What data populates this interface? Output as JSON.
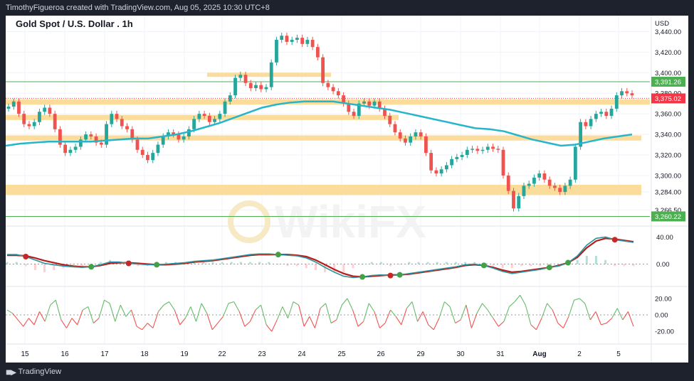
{
  "header": {
    "credit": "TimothyFigueroa created with TradingView.com, Aug 05, 2025 10:30 UTC+8"
  },
  "footer": {
    "brand": "TradingView"
  },
  "watermark": "WikiFX",
  "chart_data": {
    "type": "line",
    "title": "Gold Spot / U.S. Dollar . 1h",
    "currency": "USD",
    "price_ticks": [
      "3,440.00",
      "3,420.00",
      "3,400.00",
      "3,380.00",
      "3,360.00",
      "3,340.00",
      "3,320.00",
      "3,300.00",
      "3,284.00",
      "3,266.50"
    ],
    "current_price": "3,375.02",
    "line_labels": [
      "3,391.26",
      "3,260.22"
    ],
    "x_ticks": [
      "15",
      "16",
      "17",
      "18",
      "19",
      "22",
      "23",
      "24",
      "25",
      "26",
      "29",
      "30",
      "31",
      "Aug",
      "2",
      "5"
    ],
    "support_resistance_zones": [
      {
        "low": 3396,
        "high": 3400
      },
      {
        "low": 3369,
        "high": 3374
      },
      {
        "low": 3354,
        "high": 3359
      },
      {
        "low": 3334,
        "high": 3339
      },
      {
        "low": 3281,
        "high": 3291
      }
    ],
    "horizontal_lines": [
      3391.26,
      3260.22
    ],
    "price_series": {
      "name": "XAUUSD 1h close",
      "values": [
        3367,
        3372,
        3360,
        3350,
        3348,
        3352,
        3362,
        3366,
        3360,
        3345,
        3330,
        3322,
        3325,
        3328,
        3335,
        3340,
        3338,
        3332,
        3330,
        3350,
        3360,
        3355,
        3348,
        3345,
        3335,
        3325,
        3320,
        3315,
        3322,
        3330,
        3338,
        3342,
        3340,
        3335,
        3338,
        3345,
        3355,
        3360,
        3358,
        3352,
        3355,
        3360,
        3372,
        3378,
        3395,
        3398,
        3390,
        3385,
        3388,
        3384,
        3386,
        3410,
        3432,
        3436,
        3430,
        3432,
        3434,
        3428,
        3432,
        3425,
        3415,
        3390,
        3386,
        3382,
        3378,
        3370,
        3362,
        3358,
        3370,
        3372,
        3368,
        3372,
        3365,
        3358,
        3350,
        3342,
        3336,
        3332,
        3338,
        3342,
        3338,
        3322,
        3305,
        3302,
        3306,
        3310,
        3316,
        3318,
        3320,
        3325,
        3326,
        3324,
        3325,
        3328,
        3326,
        3325,
        3300,
        3285,
        3268,
        3280,
        3290,
        3292,
        3298,
        3302,
        3296,
        3290,
        3288,
        3284,
        3290,
        3296,
        3328,
        3352,
        3348,
        3355,
        3360,
        3362,
        3358,
        3365,
        3378,
        3382,
        3380,
        3378
      ]
    },
    "ma_series": {
      "name": "moving average",
      "values": [
        3329,
        3331,
        3332,
        3333,
        3333,
        3333,
        3333,
        3334,
        3335,
        3336,
        3336,
        3338,
        3340,
        3343,
        3347,
        3351,
        3356,
        3361,
        3366,
        3369,
        3371,
        3372,
        3372,
        3372,
        3370,
        3368,
        3366,
        3364,
        3361,
        3358,
        3355,
        3352,
        3349,
        3346,
        3345,
        3343,
        3339,
        3335,
        3332,
        3329,
        3330,
        3333,
        3336,
        3338,
        3340
      ]
    },
    "macd": {
      "ticks": [
        "40.00",
        "0.00"
      ],
      "macd_line": [
        14,
        14,
        11,
        6,
        1,
        -1,
        -3,
        -4,
        -5,
        -4,
        -1,
        3,
        3,
        1,
        0,
        -1,
        -1,
        0,
        1,
        2,
        4,
        5,
        6,
        8,
        10,
        12,
        14,
        15,
        15,
        14,
        13,
        12,
        9,
        3,
        -5,
        -12,
        -18,
        -20,
        -19,
        -17,
        -16,
        -17,
        -16,
        -14,
        -12,
        -10,
        -8,
        -6,
        -4,
        -1,
        0,
        -2,
        -6,
        -11,
        -14,
        -12,
        -10,
        -8,
        -5,
        -3,
        2,
        12,
        28,
        38,
        40,
        36,
        34,
        32
      ],
      "signal_line": [
        13,
        13,
        12,
        9,
        5,
        2,
        -1,
        -3,
        -4,
        -4,
        -2,
        1,
        2,
        2,
        1,
        0,
        -1,
        -1,
        0,
        1,
        3,
        4,
        5,
        7,
        9,
        11,
        13,
        14,
        14,
        14,
        14,
        13,
        11,
        6,
        -1,
        -8,
        -14,
        -18,
        -19,
        -18,
        -17,
        -16,
        -16,
        -15,
        -13,
        -11,
        -9,
        -7,
        -5,
        -2,
        -1,
        -2,
        -5,
        -9,
        -12,
        -11,
        -9,
        -7,
        -5,
        -2,
        2,
        10,
        24,
        34,
        38,
        37,
        35,
        33
      ]
    },
    "oscillator": {
      "ticks": [
        "20.00",
        "0.00",
        "-20.00"
      ],
      "values": [
        6,
        2,
        -6,
        -14,
        -4,
        -12,
        4,
        -8,
        12,
        18,
        -6,
        -16,
        -4,
        -12,
        6,
        10,
        -10,
        -4,
        18,
        14,
        -8,
        12,
        -2,
        6,
        -14,
        -18,
        -10,
        -16,
        4,
        12,
        16,
        6,
        -12,
        -4,
        10,
        -8,
        14,
        2,
        -18,
        -10,
        -2,
        14,
        16,
        4,
        -14,
        -8,
        6,
        12,
        -12,
        -20,
        -6,
        10,
        -4,
        16,
        12,
        -14,
        -2,
        -16,
        8,
        14,
        -10,
        -6,
        12,
        20,
        6,
        -14,
        -8,
        14,
        4,
        -16,
        -10,
        6,
        -2,
        -12,
        8,
        16,
        -8,
        4,
        -12,
        -18,
        -4,
        16,
        10,
        -10,
        -6,
        12,
        -16,
        2,
        14,
        6,
        -4,
        -14,
        -8,
        10,
        16,
        24,
        12,
        -12,
        -18,
        -4,
        14,
        6,
        -10,
        -16,
        -2,
        18,
        20,
        14,
        -6,
        4,
        -12,
        -10,
        -4,
        8,
        -6,
        4,
        -14
      ]
    }
  }
}
